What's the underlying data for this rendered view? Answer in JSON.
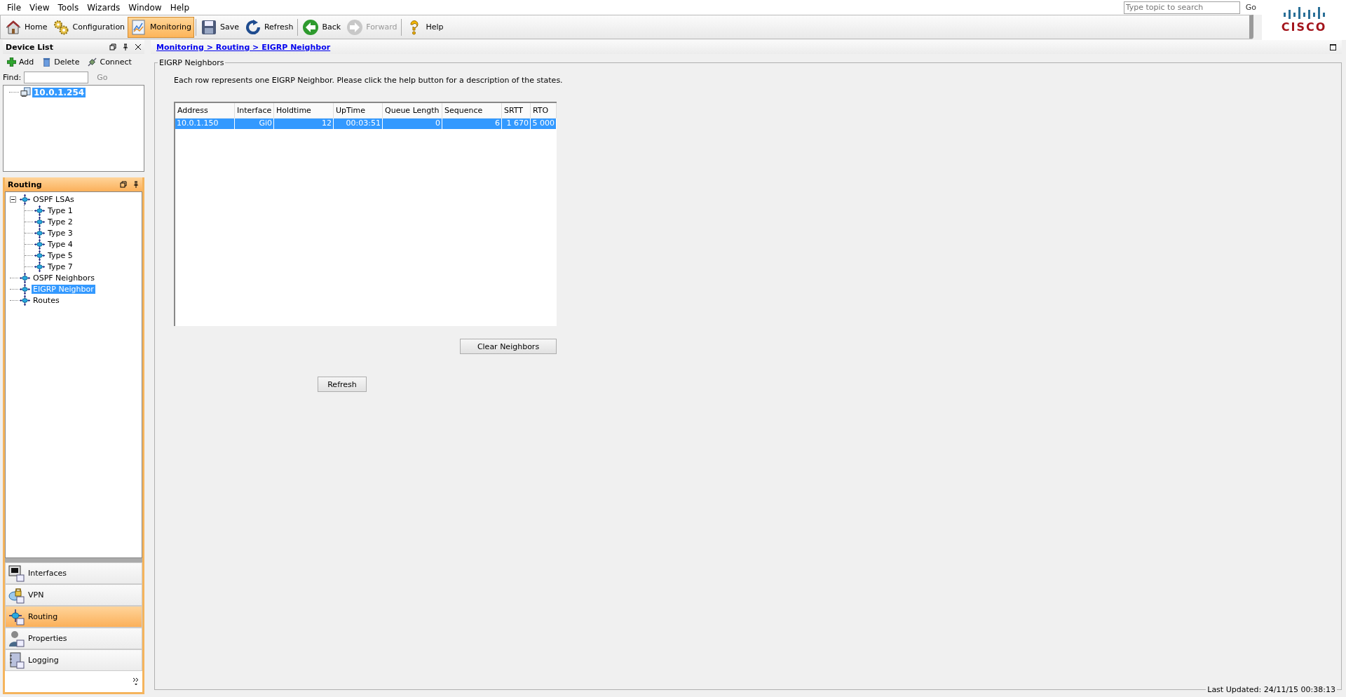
{
  "menu": [
    "File",
    "View",
    "Tools",
    "Wizards",
    "Window",
    "Help"
  ],
  "toolbar": [
    {
      "label": "Home",
      "kind": "home",
      "selected": false,
      "disabled": false
    },
    {
      "label": "Configuration",
      "kind": "configuration",
      "selected": false,
      "disabled": false
    },
    {
      "label": "Monitoring",
      "kind": "monitoring",
      "selected": true,
      "disabled": false
    },
    {
      "label": "Save",
      "kind": "save",
      "selected": false,
      "disabled": false
    },
    {
      "label": "Refresh",
      "kind": "refresh",
      "selected": false,
      "disabled": false
    },
    {
      "label": "Back",
      "kind": "back",
      "selected": false,
      "disabled": false
    },
    {
      "label": "Forward",
      "kind": "forward",
      "selected": false,
      "disabled": true
    },
    {
      "label": "Help",
      "kind": "help",
      "selected": false,
      "disabled": false
    }
  ],
  "help_search": {
    "placeholder": "Type topic to search",
    "button": "Go"
  },
  "logo": "CISCO",
  "device_list": {
    "title": "Device List",
    "actions": [
      {
        "label": "Add",
        "kind": "add"
      },
      {
        "label": "Delete",
        "kind": "delete"
      },
      {
        "label": "Connect",
        "kind": "connect"
      }
    ],
    "find": {
      "label": "Find:",
      "button": "Go"
    },
    "devices": [
      {
        "label": "10.0.1.254",
        "selected": true
      }
    ]
  },
  "routing_panel": {
    "title": "Routing",
    "tree": [
      {
        "label": "OSPF LSAs",
        "selected": false,
        "expanded": true,
        "children": [
          {
            "label": "Type 1",
            "selected": false
          },
          {
            "label": "Type 2",
            "selected": false
          },
          {
            "label": "Type 3",
            "selected": false
          },
          {
            "label": "Type 4",
            "selected": false
          },
          {
            "label": "Type 5",
            "selected": false
          },
          {
            "label": "Type 7",
            "selected": false
          }
        ]
      },
      {
        "label": "OSPF Neighbors",
        "selected": false
      },
      {
        "label": "EIGRP Neighbor",
        "selected": true
      },
      {
        "label": "Routes",
        "selected": false
      }
    ]
  },
  "nav": [
    {
      "label": "Interfaces",
      "kind": "interfaces",
      "selected": false
    },
    {
      "label": "VPN",
      "kind": "vpn",
      "selected": false
    },
    {
      "label": "Routing",
      "kind": "routing",
      "selected": true
    },
    {
      "label": "Properties",
      "kind": "properties",
      "selected": false
    },
    {
      "label": "Logging",
      "kind": "logging",
      "selected": false
    }
  ],
  "content": {
    "breadcrumb": "Monitoring > Routing > EIGRP Neighbor",
    "group_title": "EIGRP Neighbors",
    "description": "Each row represents one EIGRP Neighbor. Please click the help button for a description of the states.",
    "table": {
      "columns": [
        "Address",
        "Interface",
        "Holdtime",
        "UpTime",
        "Queue Length",
        "Sequence",
        "SRTT",
        "RTO"
      ],
      "rows": [
        {
          "cells": [
            "10.0.1.150",
            "Gi0",
            "12",
            "00:03:51",
            "0",
            "6",
            "1 670",
            "5 000"
          ],
          "selected": true
        }
      ]
    },
    "clear_button": "Clear Neighbors",
    "refresh_button": "Refresh",
    "last_updated": "Last Updated: 24/11/15 00:38:13"
  }
}
